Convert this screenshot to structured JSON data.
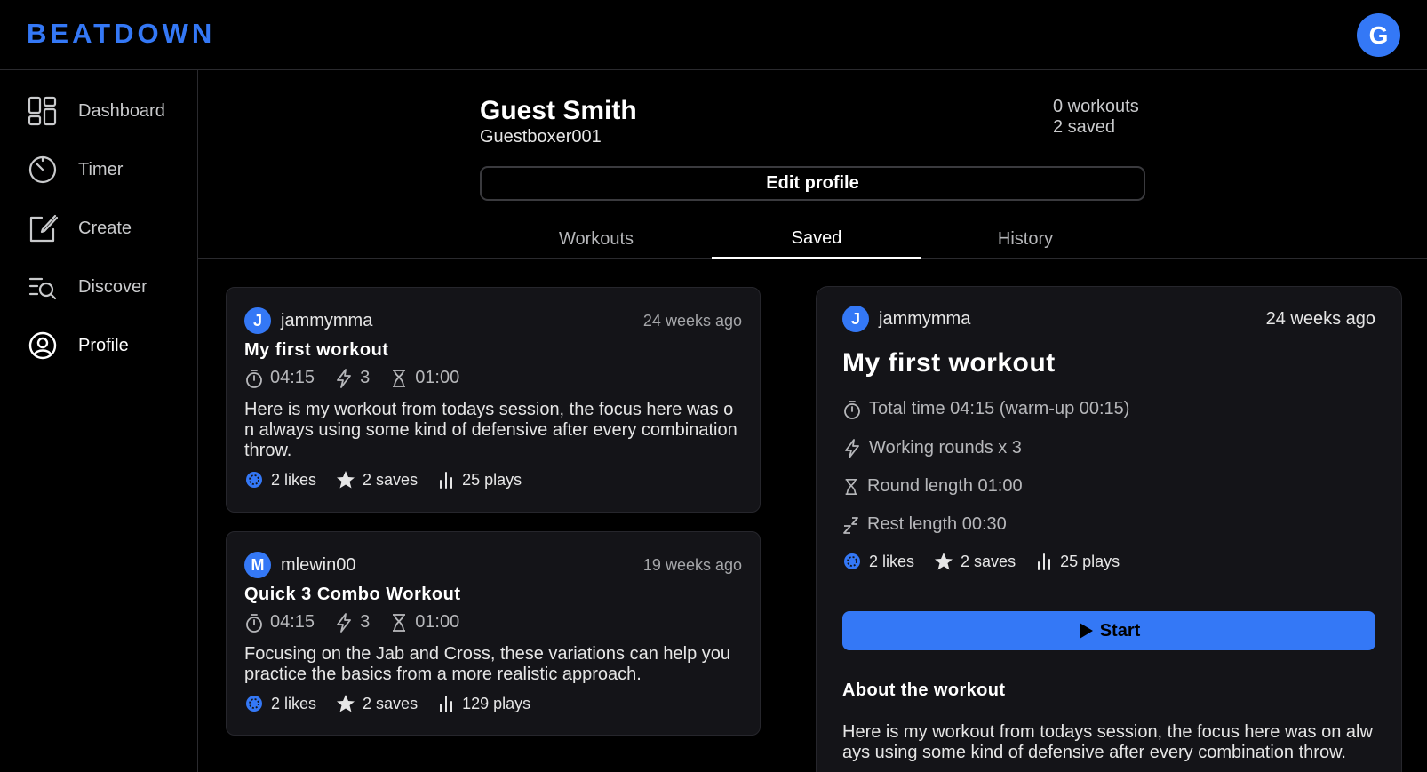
{
  "app": {
    "logo": "BEATDOWN",
    "user_initial": "G"
  },
  "sidebar": {
    "items": [
      {
        "label": "Dashboard",
        "icon": "dashboard-grid-icon",
        "active": false
      },
      {
        "label": "Timer",
        "icon": "timer-icon",
        "active": false
      },
      {
        "label": "Create",
        "icon": "create-edit-icon",
        "active": false
      },
      {
        "label": "Discover",
        "icon": "discover-search-icon",
        "active": false
      },
      {
        "label": "Profile",
        "icon": "profile-user-icon",
        "active": true
      }
    ]
  },
  "profile": {
    "name": "Guest Smith",
    "handle": "Guestboxer001",
    "workouts_count": "0 workouts",
    "saved_count": "2 saved",
    "edit_label": "Edit profile"
  },
  "tabs": [
    {
      "label": "Workouts",
      "active": false
    },
    {
      "label": "Saved",
      "active": true
    },
    {
      "label": "History",
      "active": false
    }
  ],
  "workouts": [
    {
      "initial": "J",
      "user": "jammymma",
      "ago": "24 weeks ago",
      "title": "My first workout",
      "total": "04:15",
      "rounds": "3",
      "round_length": "01:00",
      "description": "Here is my workout from todays session, the focus here was on always using some kind of defensive after every combination throw.",
      "likes": "2 likes",
      "saves": "2 saves",
      "plays": "25 plays"
    },
    {
      "initial": "M",
      "user": "mlewin00",
      "ago": "19 weeks ago",
      "title": "Quick 3 Combo Workout",
      "total": "04:15",
      "rounds": "3",
      "round_length": "01:00",
      "description": "Focusing on the Jab and Cross, these variations can help you practice the basics from a more realistic approach.",
      "likes": "2 likes",
      "saves": "2 saves",
      "plays": "129 plays"
    }
  ],
  "detail": {
    "initial": "J",
    "user": "jammymma",
    "ago": "24 weeks ago",
    "title": "My first workout",
    "total_time": "Total time 04:15 (warm-up 00:15)",
    "working_rounds": "Working rounds x 3",
    "round_length": "Round length 01:00",
    "rest_length": "Rest length 00:30",
    "likes": "2 likes",
    "saves": "2 saves",
    "plays": "25 plays",
    "start_label": "Start",
    "about_title": "About the workout",
    "about_text": "Here is my workout from todays session, the focus here was on always using some kind of defensive after every combination throw."
  },
  "colors": {
    "accent": "#3478f6",
    "background": "#000000",
    "card": "#141418",
    "muted": "#b6b7ba"
  }
}
